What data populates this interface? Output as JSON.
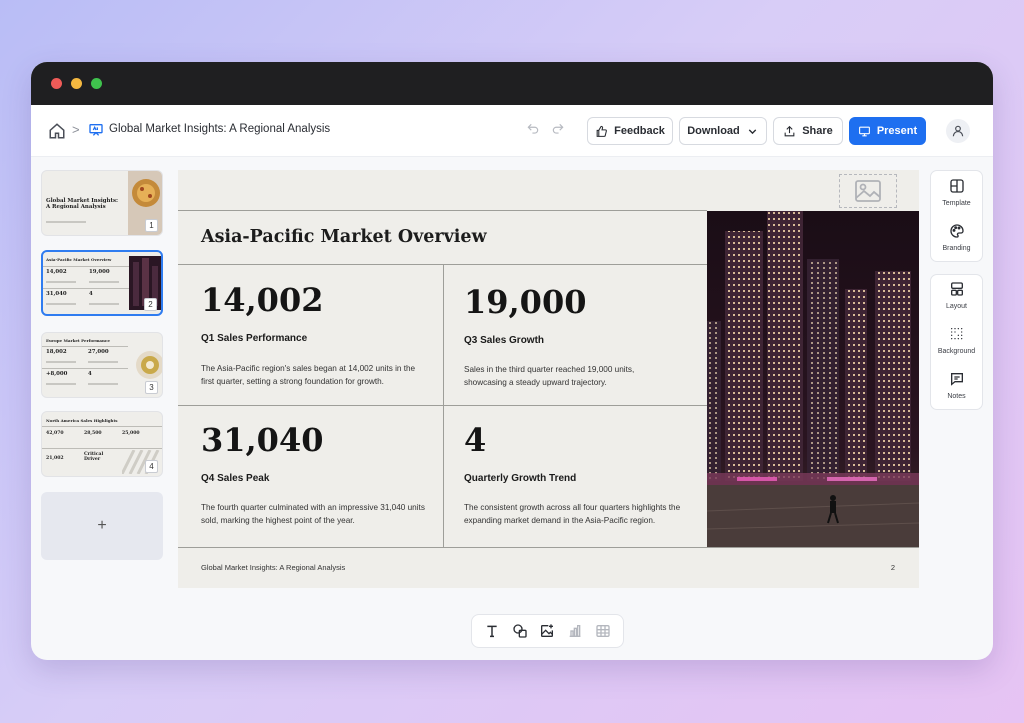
{
  "app": {
    "doc_title": "Global Market Insights: A Regional Analysis",
    "breadcrumb_sep": ">"
  },
  "toolbar": {
    "feedback_label": "Feedback",
    "download_label": "Download",
    "share_label": "Share",
    "present_label": "Present"
  },
  "thumbnails": [
    {
      "number": "1",
      "title": "Global Market Insights: A Regional Analysis"
    },
    {
      "number": "2",
      "title": "Asia-Pacific Market Overview",
      "stats": [
        "14,002",
        "19,000",
        "31,040",
        "4"
      ]
    },
    {
      "number": "3",
      "title": "Europe Market Performance",
      "stats": [
        "18,002",
        "27,000",
        "+8,000",
        "4"
      ]
    },
    {
      "number": "4",
      "title": "North America Sales Highlights",
      "stats": [
        "42,070",
        "28,500",
        "25,000",
        "21,002",
        "Critical Driver"
      ]
    }
  ],
  "add_slide_label": "+",
  "slide": {
    "title": "Asia-Pacific Market Overview",
    "stats": [
      {
        "value": "14,002",
        "heading": "Q1 Sales Performance",
        "body": "The Asia-Pacific region's sales began at 14,002 units in the first quarter, setting a strong foundation for growth."
      },
      {
        "value": "19,000",
        "heading": "Q3 Sales Growth",
        "body": "Sales in the third quarter reached 19,000 units, showcasing a steady upward trajectory."
      },
      {
        "value": "31,040",
        "heading": "Q4 Sales Peak",
        "body": "The fourth quarter culminated with an impressive 31,040 units sold, marking the highest point of the year."
      },
      {
        "value": "4",
        "heading": "Quarterly Growth Trend",
        "body": "The consistent growth across all four quarters highlights the expanding market demand in the Asia-Pacific region."
      }
    ],
    "footer": "Global Market Insights: A Regional Analysis",
    "page_number": "2"
  },
  "right_panel": {
    "template": "Template",
    "branding": "Branding",
    "layout": "Layout",
    "background": "Background",
    "notes": "Notes"
  },
  "colors": {
    "accent": "#1e6ff0",
    "slide_bg": "#efeeea",
    "titlebar": "#1f1f21"
  }
}
